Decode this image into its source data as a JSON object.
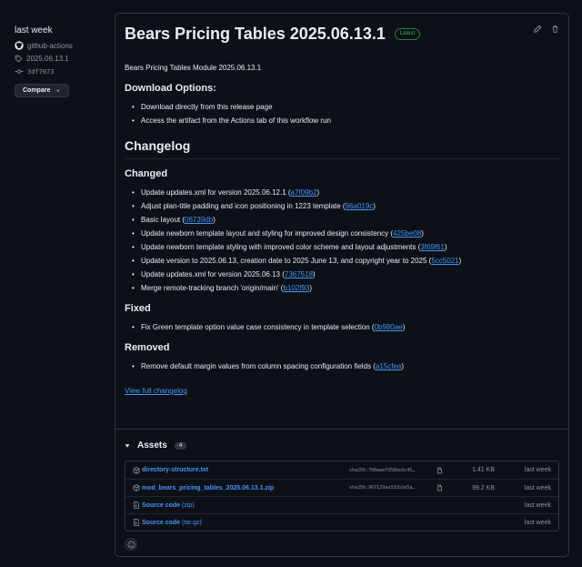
{
  "sidebar": {
    "when": "last week",
    "author": "github-actions",
    "tag": "2025.06.13.1",
    "commit": "3df7073",
    "compare_label": "Compare"
  },
  "release": {
    "title": "Bears Pricing Tables 2025.06.13.1",
    "badge": "Latest",
    "intro": "Bears Pricing Tables Module 2025.06.13.1",
    "download_heading": "Download Options:",
    "download_items": [
      "Download directly from this release page",
      "Access the artifact from the Actions tab of this workflow run"
    ],
    "changelog_heading": "Changelog",
    "changed_heading": "Changed",
    "changed_items": [
      {
        "text": "Update updates.xml for version 2025.06.12.1 (",
        "hash": "a7f09b2"
      },
      {
        "text": "Adjust plan-title padding and icon positioning in 1223 template (",
        "hash": "96a019c"
      },
      {
        "text": "Basic layout (",
        "hash": "06739db"
      },
      {
        "text": "Update newborn template layout and styling for improved design consistency (",
        "hash": "425be08"
      },
      {
        "text": "Update newborn template styling with improved color scheme and layout adjustments (",
        "hash": "3f69f61"
      },
      {
        "text": "Update version to 2025.06.13, creation date to 2025 June 13, and copyright year to 2025 (",
        "hash": "5cc5021"
      },
      {
        "text": "Update updates.xml for version 2025.06.13 (",
        "hash": "7367518"
      },
      {
        "text": "Merge remote-tracking branch 'origin/main' (",
        "hash": "b102f93"
      }
    ],
    "fixed_heading": "Fixed",
    "fixed_items": [
      {
        "text": "Fix Green template option value case consistency in template selection (",
        "hash": "0b980ae"
      }
    ],
    "removed_heading": "Removed",
    "removed_items": [
      {
        "text": "Remove default margin values from column spacing configuration fields (",
        "hash": "a15cfea"
      }
    ],
    "full_changelog": "View full changelog",
    "close_paren": ")"
  },
  "assets": {
    "label": "Assets",
    "count": "4",
    "items": [
      {
        "name": "directory-structure.txt",
        "ext": "",
        "sha": "sha256:7b0aaef356bedc45…",
        "size": "1.41 KB",
        "date": "last week",
        "icon": "package-icon"
      },
      {
        "name": "mod_bears_pricing_tables_2025.06.13.1.zip",
        "ext": "",
        "sha": "sha256:967129aa332b2e5a…",
        "size": "99.2 KB",
        "date": "last week",
        "icon": "package-icon"
      },
      {
        "name": "Source code",
        "ext": "(zip)",
        "sha": "",
        "size": "",
        "date": "last week",
        "icon": "file-zip-icon"
      },
      {
        "name": "Source code",
        "ext": "(tar.gz)",
        "sha": "",
        "size": "",
        "date": "last week",
        "icon": "file-zip-icon"
      }
    ]
  },
  "colors": {
    "link": "#4493f8",
    "latest": "#3fb950",
    "bg": "#0d1117",
    "border": "#30363d"
  }
}
